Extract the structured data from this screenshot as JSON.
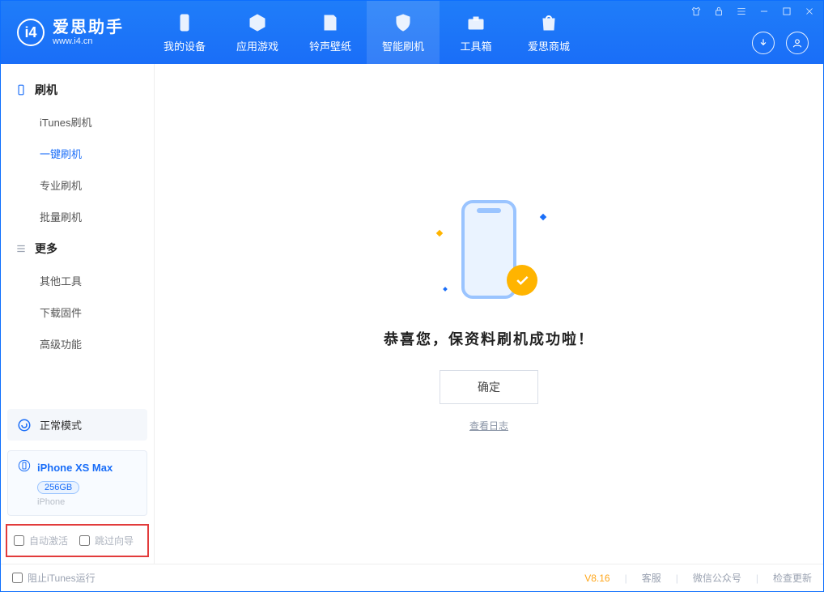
{
  "app": {
    "title_cn": "爱思助手",
    "title_en": "www.i4.cn"
  },
  "nav": {
    "items": [
      {
        "label": "我的设备"
      },
      {
        "label": "应用游戏"
      },
      {
        "label": "铃声壁纸"
      },
      {
        "label": "智能刷机"
      },
      {
        "label": "工具箱"
      },
      {
        "label": "爱思商城"
      }
    ],
    "active_index": 3
  },
  "sidebar": {
    "group1": {
      "heading": "刷机",
      "items": [
        "iTunes刷机",
        "一键刷机",
        "专业刷机",
        "批量刷机"
      ],
      "active_index": 1
    },
    "group2": {
      "heading": "更多",
      "items": [
        "其他工具",
        "下载固件",
        "高级功能"
      ]
    },
    "mode": "正常模式",
    "device": {
      "name": "iPhone XS Max",
      "capacity": "256GB",
      "type": "iPhone"
    },
    "checks": {
      "auto_activate": "自动激活",
      "skip_guide": "跳过向导"
    }
  },
  "main": {
    "headline": "恭喜您，保资料刷机成功啦！",
    "ok": "确定",
    "view_log": "查看日志"
  },
  "status": {
    "stop_itunes": "阻止iTunes运行",
    "version": "V8.16",
    "links": [
      "客服",
      "微信公众号",
      "检查更新"
    ]
  }
}
